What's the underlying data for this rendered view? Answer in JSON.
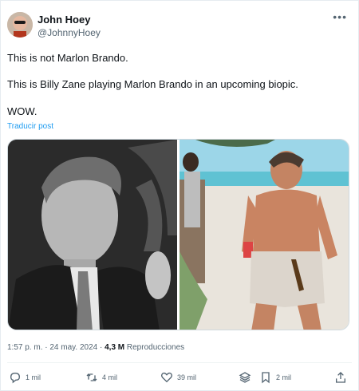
{
  "user": {
    "name": "John Hoey",
    "handle": "@JohnnyHoey"
  },
  "tweet": {
    "line1": "This is not Marlon Brando.",
    "line2": "This is Billy Zane playing Marlon Brando in an upcoming biopic.",
    "line3": "WOW.",
    "translate": "Traducir post"
  },
  "meta": {
    "time": "1:57 p. m. · 24 may. 2024 · ",
    "views": "4,3 M",
    "views_label": " Reproducciones"
  },
  "actions": {
    "replies": "1 mil",
    "reposts": "4 mil",
    "likes": "39 mil",
    "bookmarks": "2 mil"
  },
  "icons": [
    "more-icon",
    "reply-icon",
    "repost-icon",
    "like-icon",
    "views-icon",
    "bookmark-icon",
    "share-icon"
  ],
  "colors": {
    "link": "#1d9bf0",
    "muted": "#536471",
    "text": "#0f1419"
  }
}
